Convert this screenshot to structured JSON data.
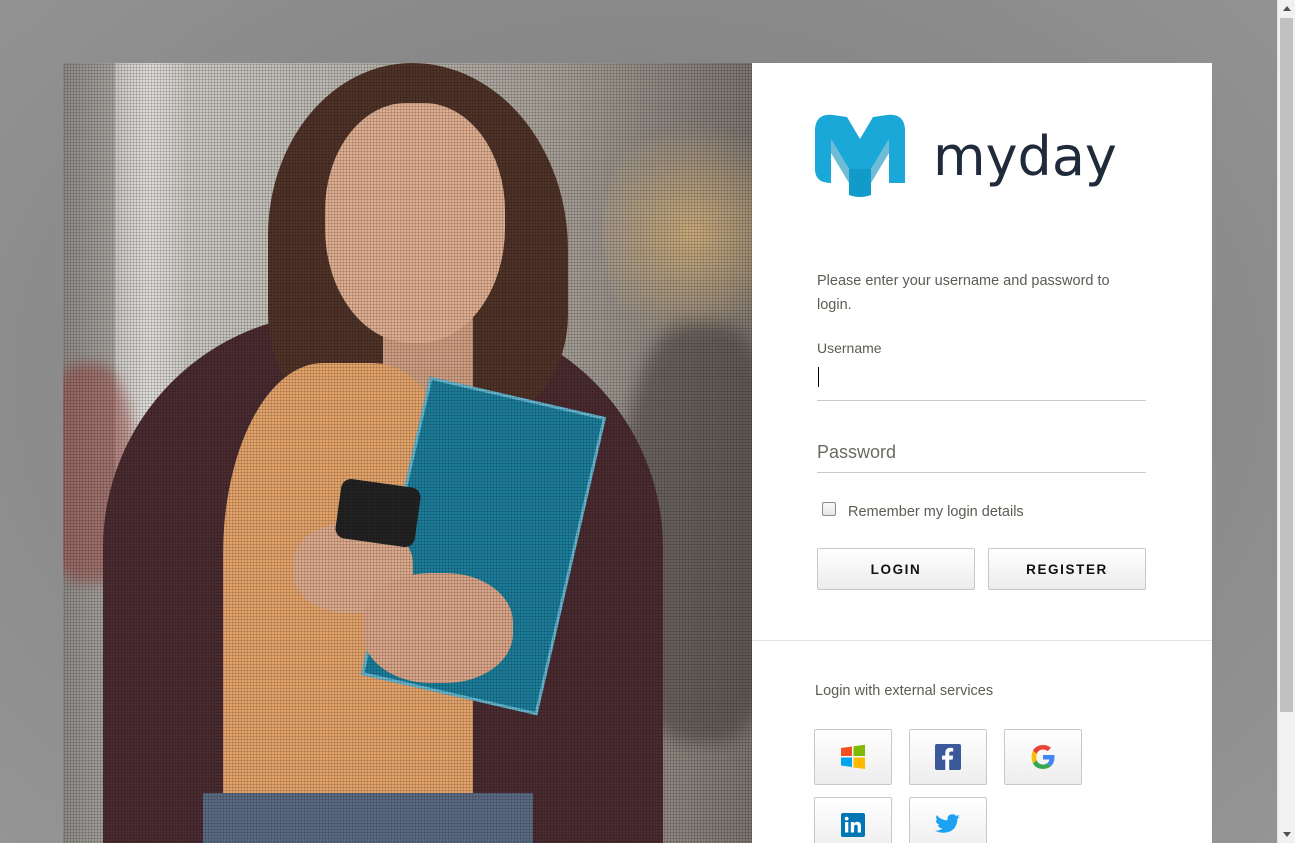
{
  "brand": {
    "name": "myday",
    "mark_color": "#1aa8d8",
    "text_color": "#1f2a3a"
  },
  "login": {
    "instructions": "Please enter your username and password to login.",
    "username_label": "Username",
    "username_value": "",
    "password_placeholder": "Password",
    "password_value": "",
    "remember_label": "Remember my login details",
    "remember_checked": false,
    "login_button": "LOGIN",
    "register_button": "REGISTER"
  },
  "external": {
    "label": "Login with external services",
    "services": [
      {
        "name": "Microsoft",
        "icon": "windows-icon"
      },
      {
        "name": "Facebook",
        "icon": "facebook-icon"
      },
      {
        "name": "Google",
        "icon": "google-icon"
      },
      {
        "name": "LinkedIn",
        "icon": "linkedin-icon"
      },
      {
        "name": "Twitter",
        "icon": "twitter-icon"
      }
    ]
  },
  "hero": {
    "description_icon": "student-photo"
  }
}
